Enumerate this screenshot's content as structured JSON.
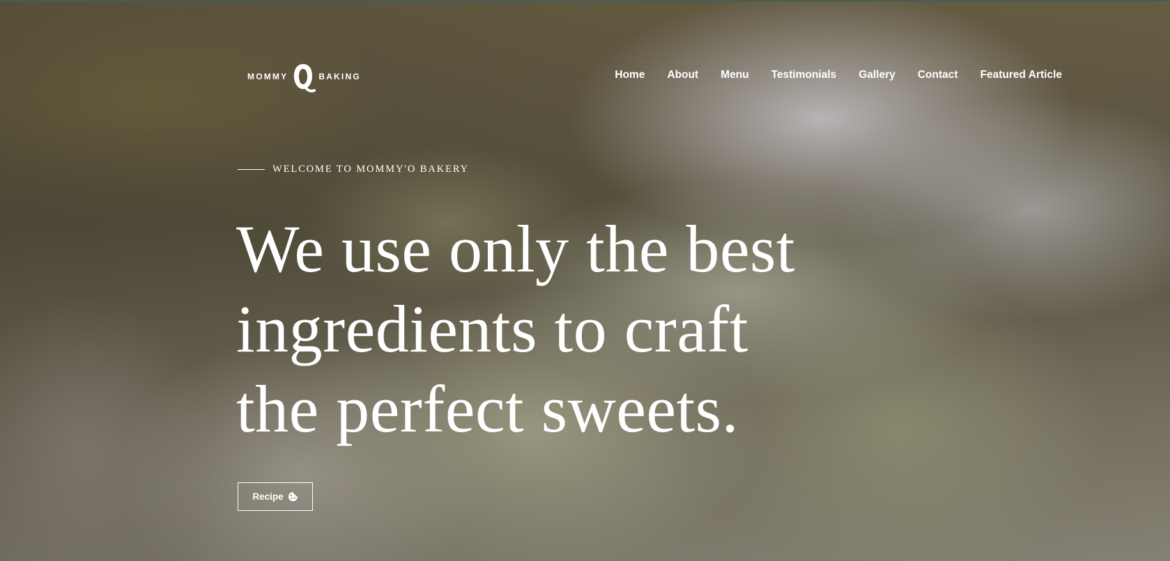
{
  "brand": {
    "left": "MOMMY",
    "right": "BAKING",
    "icon": "mommy-o-logo-mark"
  },
  "nav": {
    "items": [
      "Home",
      "About",
      "Menu",
      "Testimonials",
      "Gallery",
      "Contact",
      "Featured Article"
    ]
  },
  "hero": {
    "eyebrow": "WELCOME TO MOMMY'O BAKERY",
    "headline_lines": [
      "We use only the best",
      "ingredients to craft",
      "the perfect sweets."
    ],
    "button_label": "Recipe",
    "button_icon": "cookie-icon",
    "background": "blurred braided dough photo"
  },
  "colors": {
    "text": "#ffffff",
    "overlay_tint": "#5f5a48"
  }
}
